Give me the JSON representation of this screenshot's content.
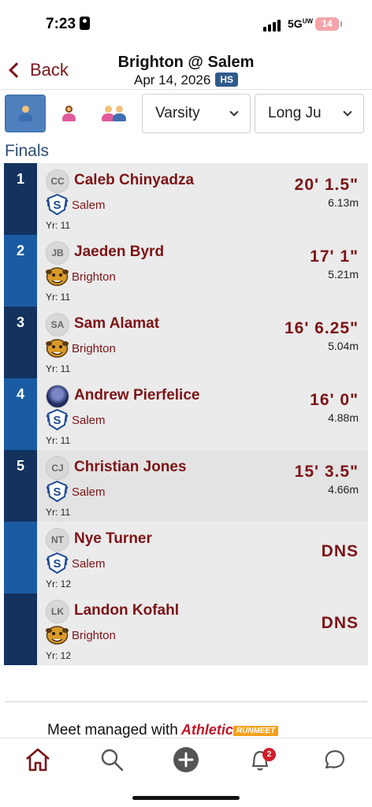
{
  "status_bar": {
    "time": "7:23",
    "network": "5G",
    "network_suffix": "UW",
    "battery": "14"
  },
  "header": {
    "back_label": "Back",
    "title": "Brighton @ Salem",
    "date": "Apr 14, 2026",
    "level_badge": "HS"
  },
  "filters": {
    "gender_options": [
      "boys",
      "girls",
      "coed"
    ],
    "selected_gender": "boys",
    "level_value": "Varsity",
    "event_value": "Long Ju"
  },
  "section_title": "Finals",
  "results": [
    {
      "place": "1",
      "initials": "CC",
      "name": "Caleb Chinyadza",
      "team": "Salem",
      "year": "Yr: 11",
      "mark": "20' 1.5\"",
      "metric": "6.13m"
    },
    {
      "place": "2",
      "initials": "JB",
      "name": "Jaeden Byrd",
      "team": "Brighton",
      "year": "Yr: 11",
      "mark": "17' 1\"",
      "metric": "5.21m"
    },
    {
      "place": "3",
      "initials": "SA",
      "name": "Sam Alamat",
      "team": "Brighton",
      "year": "Yr: 11",
      "mark": "16' 6.25\"",
      "metric": "5.04m"
    },
    {
      "place": "4",
      "initials": "",
      "name": "Andrew Pierfelice",
      "team": "Salem",
      "year": "Yr: 11",
      "mark": "16' 0\"",
      "metric": "4.88m"
    },
    {
      "place": "5",
      "initials": "CJ",
      "name": "Christian Jones",
      "team": "Salem",
      "year": "Yr: 11",
      "mark": "15' 3.5\"",
      "metric": "4.66m"
    },
    {
      "place": "",
      "initials": "NT",
      "name": "Nye Turner",
      "team": "Salem",
      "year": "Yr: 12",
      "mark": "DNS",
      "metric": ""
    },
    {
      "place": "",
      "initials": "LK",
      "name": "Landon Kofahl",
      "team": "Brighton",
      "year": "Yr: 12",
      "mark": "DNS",
      "metric": ""
    }
  ],
  "footer": {
    "managed_text": "Meet managed with",
    "brand": "Athletic",
    "brand_tag": "RUNMEET"
  },
  "tabbar": {
    "items": [
      "home",
      "search",
      "add",
      "notifications",
      "messages"
    ],
    "notification_count": "2"
  },
  "colors": {
    "maroon": "#7d1416",
    "navy": "#13325e",
    "blue": "#1a5ca3",
    "accent_blue": "#4d80bd"
  }
}
